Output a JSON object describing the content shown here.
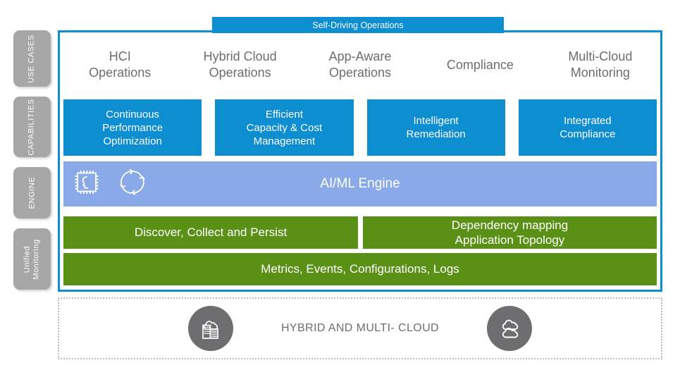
{
  "banner": {
    "label": "Self-Driving Operations"
  },
  "rail": {
    "items": [
      {
        "label": "USE CASES",
        "name": "use-cases"
      },
      {
        "label": "CAPABILITIES",
        "name": "capabilities"
      },
      {
        "label": "ENGINE",
        "name": "engine"
      },
      {
        "label": "Unified\nMonitoring",
        "name": "unified-monitoring"
      }
    ]
  },
  "use_cases": {
    "items": [
      {
        "label": "HCI\nOperations"
      },
      {
        "label": "Hybrid Cloud\nOperations"
      },
      {
        "label": "App-Aware\nOperations"
      },
      {
        "label": "Compliance"
      },
      {
        "label": "Multi-Cloud\nMonitoring"
      }
    ]
  },
  "capabilities": {
    "items": [
      {
        "label": "Continuous\nPerformance\nOptimization"
      },
      {
        "label": "Efficient\nCapacity & Cost\nManagement"
      },
      {
        "label": "Intelligent\nRemediation"
      },
      {
        "label": "Integrated\nCompliance"
      }
    ]
  },
  "engine": {
    "label": "AI/ML Engine",
    "icons": [
      "ai-chip-icon",
      "ml-cycle-icon"
    ]
  },
  "data_layer": {
    "discover": "Discover, Collect and Persist",
    "dependency": "Dependency mapping\nApplication Topology",
    "metrics": "Metrics, Events, Configurations, Logs"
  },
  "cloud_strip": {
    "label": "HYBRID AND MULTI- CLOUD",
    "left_icon": "hybrid-cloud-datacenter-icon",
    "right_icon": "multi-cloud-icon"
  },
  "colors": {
    "blue": "#0d8ed0",
    "green": "#5a9016",
    "engine_blue": "#8aa9e8",
    "rail_gray": "#a6a6a6",
    "circle_gray": "#6e6e70",
    "text_gray": "#6e6e6e",
    "dotted_border": "#bdbdbd"
  }
}
